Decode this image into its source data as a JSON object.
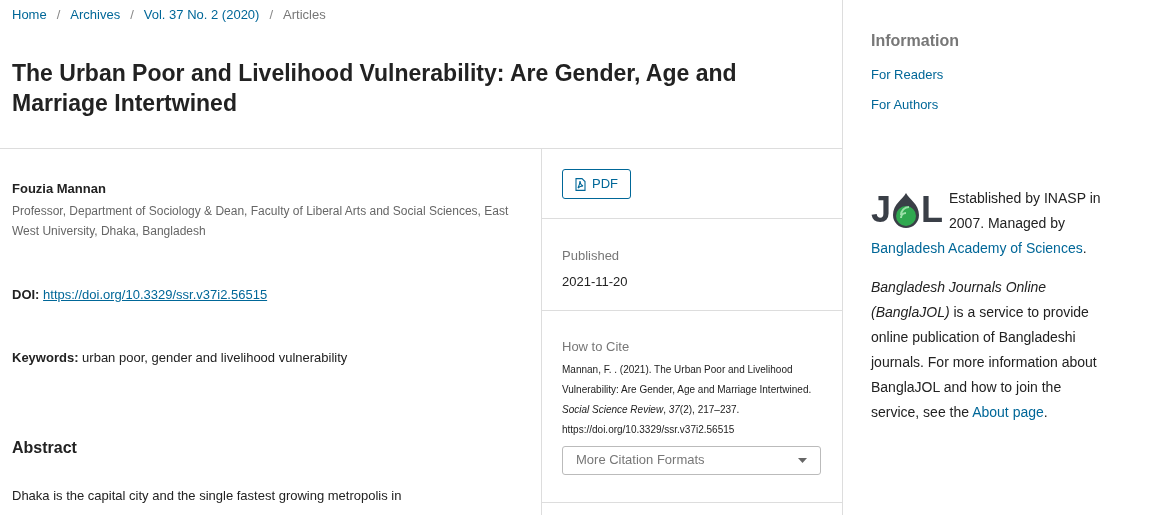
{
  "breadcrumbs": [
    {
      "label": "Home",
      "link": true
    },
    {
      "label": "Archives",
      "link": true
    },
    {
      "label": "Vol. 37 No. 2 (2020)",
      "link": true
    },
    {
      "label": "Articles",
      "link": false
    }
  ],
  "separator": "/",
  "title": "The Urban Poor and Livelihood Vulnerability: Are Gender, Age and Marriage Intertwined",
  "author": {
    "name": "Fouzia Mannan",
    "affiliation": "Professor, Department of Sociology & Dean, Faculty of Liberal Arts and Social Sciences, East West University, Dhaka, Bangladesh"
  },
  "doi": {
    "label": "DOI:",
    "value": "https://doi.org/10.3329/ssr.v37i2.56515"
  },
  "keywords": {
    "label": "Keywords:",
    "value": "urban poor, gender and livelihood vulnerability"
  },
  "abstract": {
    "heading": "Abstract",
    "text": "Dhaka is the capital city and the single fastest growing metropolis in"
  },
  "pdf_button": "PDF",
  "published": {
    "label": "Published",
    "value": "2021-11-20"
  },
  "how_to_cite": {
    "label": "How to Cite",
    "citation": "Mannan, F. . (2021). The Urban Poor and Livelihood Vulnerability: Are Gender, Age and Marriage Intertwined. *Social Science Review*, *37*(2), 217–237. https://doi.org/10.3329/ssr.v37i2.56515",
    "formats_button": "More Citation Formats"
  },
  "sidebar": {
    "heading": "Information",
    "links": [
      "For Readers",
      "For Authors"
    ],
    "logo": {
      "left": "J",
      "right": "L"
    },
    "paragraphs": [
      [
        {
          "text": "Established by INASP in 2007. Managed by ",
          "link": false
        },
        {
          "text": "Bangladesh Academy of Sciences",
          "link": true
        },
        {
          "text": ".",
          "link": false
        }
      ],
      [
        {
          "text": "*Bangladesh Journals Online (BanglaJOL)* is a service to provide online publication of Bangladeshi journals. For more information about BanglaJOL and how to join the service, see the ",
          "link": false
        },
        {
          "text": "About page",
          "link": true
        },
        {
          "text": ".",
          "link": false
        }
      ]
    ]
  }
}
